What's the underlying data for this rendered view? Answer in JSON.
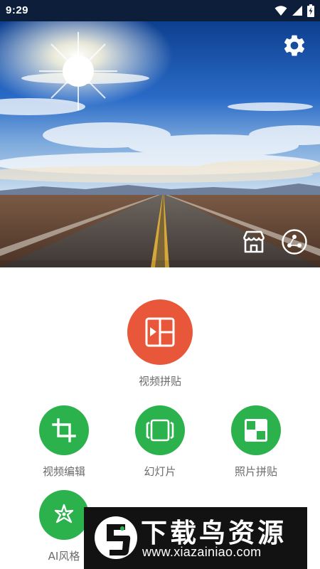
{
  "status_bar": {
    "time": "9:29",
    "icons": [
      "wifi-icon",
      "signal-icon",
      "battery-charging-icon"
    ]
  },
  "hero": {
    "icons": [
      "gear-icon",
      "store-icon",
      "share-icon"
    ]
  },
  "features": {
    "video_collage": {
      "label": "视频拼贴",
      "icon": "collage-play-icon",
      "color": "#e8573a"
    },
    "video_edit": {
      "label": "视频编辑",
      "icon": "crop-icon",
      "color": "#2bb24c"
    },
    "slideshow": {
      "label": "幻灯片",
      "icon": "slides-icon",
      "color": "#2bb24c"
    },
    "photo_collage": {
      "label": "照片拼贴",
      "icon": "photo-grid-icon",
      "color": "#2bb24c"
    },
    "ai_style": {
      "label": "AI风格",
      "icon": "sparkle-icon",
      "color": "#2bb24c"
    }
  },
  "watermark": {
    "title": "下载鸟资源",
    "url": "www.xiazainiao.com"
  }
}
